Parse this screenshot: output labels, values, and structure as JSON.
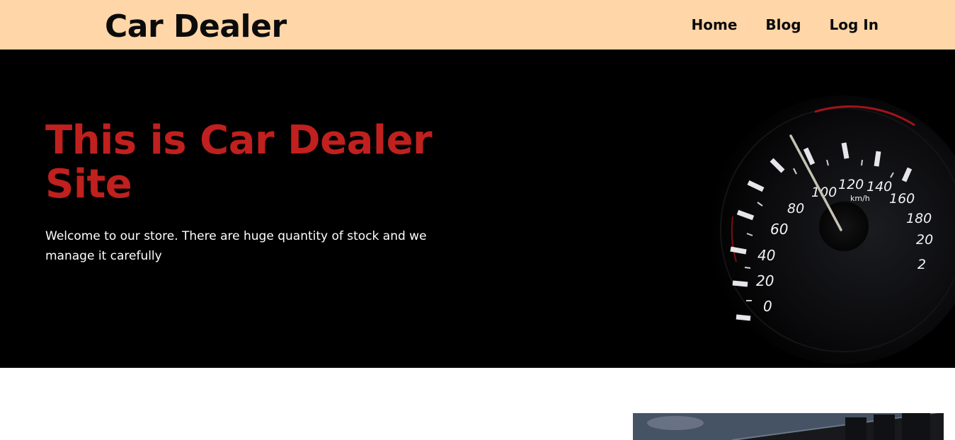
{
  "header": {
    "brand": "Car Dealer",
    "nav": [
      {
        "label": "Home"
      },
      {
        "label": "Blog"
      },
      {
        "label": "Log In"
      }
    ]
  },
  "hero": {
    "title": "This is Car Dealer Site",
    "text": "Welcome to our store. There are huge quantity of stock and we manage it carefully"
  },
  "speedometer": {
    "labels": [
      "0",
      "20",
      "40",
      "60",
      "80",
      "100",
      "120",
      "140",
      "160",
      "180",
      "20",
      "2"
    ],
    "unit": "km/h"
  },
  "colors": {
    "header_bg": "#ffd6a8",
    "hero_bg": "#000000",
    "accent_red": "#c0201e"
  }
}
